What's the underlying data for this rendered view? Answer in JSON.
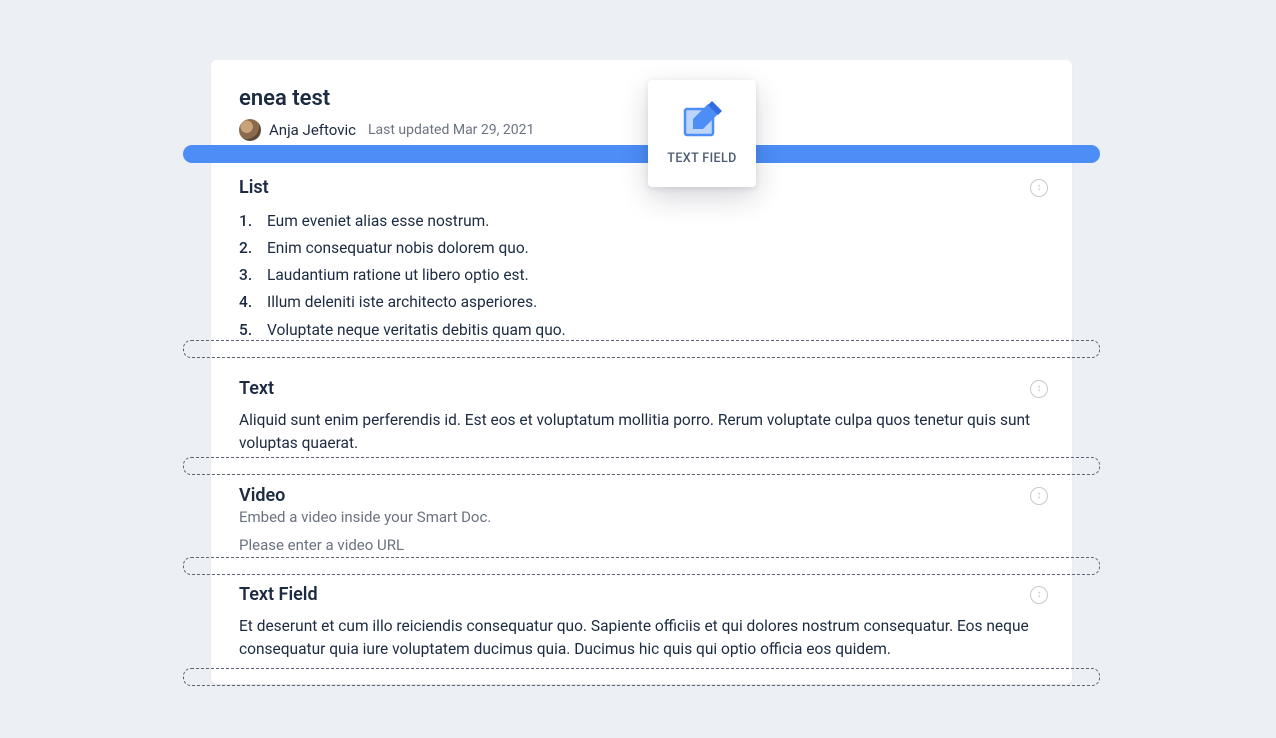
{
  "doc": {
    "title": "enea test",
    "author": "Anja Jeftovic",
    "updated": "Last updated Mar 29, 2021"
  },
  "sections": {
    "list": {
      "heading": "List",
      "items": [
        "Eum eveniet alias esse nostrum.",
        "Enim consequatur nobis dolorem quo.",
        "Laudantium ratione ut libero optio est.",
        "Illum deleniti iste architecto asperiores.",
        "Voluptate neque veritatis debitis quam quo."
      ]
    },
    "text": {
      "heading": "Text",
      "body": "Aliquid sunt enim perferendis id. Est eos et voluptatum mollitia porro. Rerum voluptate culpa quos tenetur quis sunt voluptas quaerat."
    },
    "video": {
      "heading": "Video",
      "subtext": "Embed a video inside your Smart Doc.",
      "placeholder": "Please enter a video URL"
    },
    "textfield": {
      "heading": "Text Field",
      "body": "Et deserunt et cum illo reiciendis consequatur quo. Sapiente officiis et qui dolores nostrum consequatur. Eos neque consequatur quia iure voluptatem ducimus quia. Ducimus hic quis qui optio officia eos quidem."
    }
  },
  "dragTile": {
    "label": "TEXT FIELD",
    "icon": "edit-square-icon"
  }
}
